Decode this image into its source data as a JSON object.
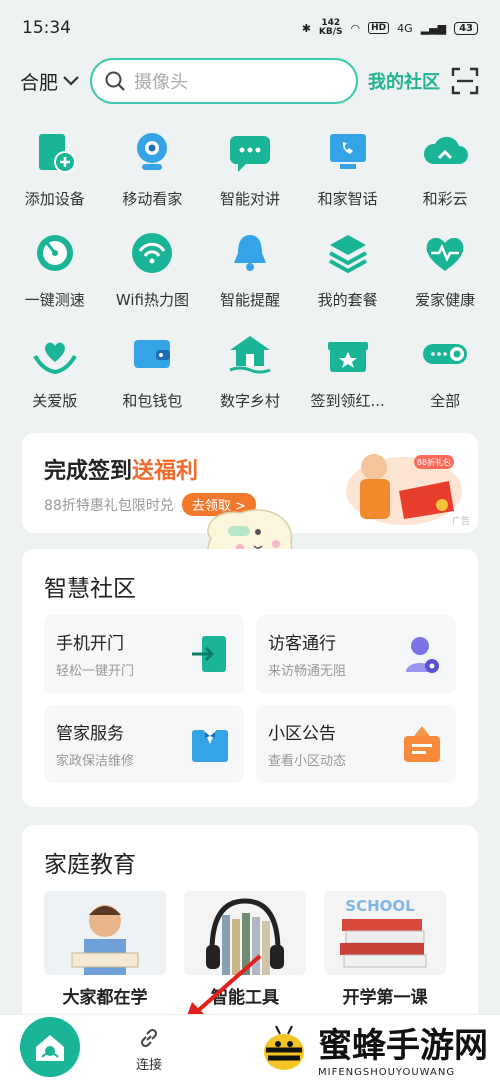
{
  "status": {
    "time": "15:34",
    "speed_value": "142",
    "speed_unit": "KB/S",
    "hd": "HD",
    "network": "4G",
    "battery": "43"
  },
  "header": {
    "city": "合肥",
    "search_placeholder": "摄像头",
    "community": "我的社区"
  },
  "grid": [
    {
      "label": "添加设备",
      "icon": "add-device-icon"
    },
    {
      "label": "移动看家",
      "icon": "camera-icon"
    },
    {
      "label": "智能对讲",
      "icon": "chat-icon"
    },
    {
      "label": "和家智话",
      "icon": "phone-screen-icon"
    },
    {
      "label": "和彩云",
      "icon": "cloud-icon"
    },
    {
      "label": "一键测速",
      "icon": "speedometer-icon"
    },
    {
      "label": "Wifi热力图",
      "icon": "wifi-icon"
    },
    {
      "label": "智能提醒",
      "icon": "bell-icon"
    },
    {
      "label": "我的套餐",
      "icon": "layers-icon"
    },
    {
      "label": "爱家健康",
      "icon": "heart-pulse-icon"
    },
    {
      "label": "关爱版",
      "icon": "care-hands-icon"
    },
    {
      "label": "和包钱包",
      "icon": "wallet-icon"
    },
    {
      "label": "数字乡村",
      "icon": "village-icon"
    },
    {
      "label": "签到领红...",
      "icon": "gift-icon"
    },
    {
      "label": "全部",
      "icon": "all-toggle-icon"
    }
  ],
  "promo": {
    "title_a": "完成签到",
    "title_b": "送福利",
    "subtitle": "88折特惠礼包限时兑",
    "button": "去领取 >",
    "badge": "88折礼包",
    "ad": "广告"
  },
  "community": {
    "title": "智慧社区",
    "tiles": [
      {
        "title": "手机开门",
        "sub": "轻松一键开门"
      },
      {
        "title": "访客通行",
        "sub": "来访畅通无阻"
      },
      {
        "title": "管家服务",
        "sub": "家政保洁维修"
      },
      {
        "title": "小区公告",
        "sub": "查看小区动态"
      }
    ]
  },
  "education": {
    "title": "家庭教育",
    "items": [
      {
        "label": "大家都在学"
      },
      {
        "label": "智能工具"
      },
      {
        "label": "开学第一课"
      }
    ],
    "book_text": "SCHOOL"
  },
  "nav": {
    "connect": "连接"
  },
  "watermark": {
    "main": "蜜蜂手游网",
    "sub": "MIFENGSHOUYOUWANG"
  },
  "colors": {
    "accent": "#19b596",
    "orange": "#f26a2c"
  }
}
